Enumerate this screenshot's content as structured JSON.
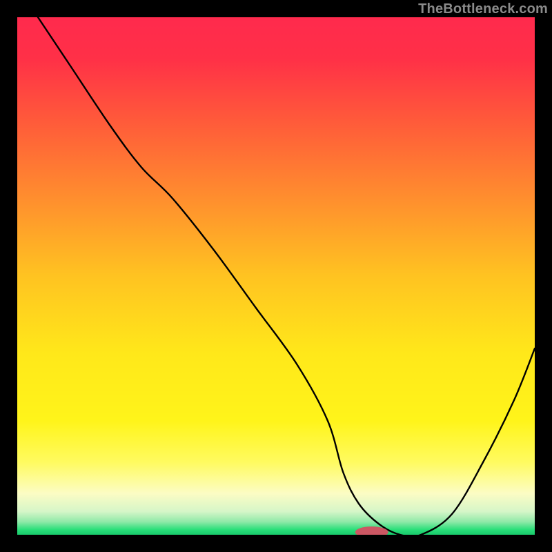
{
  "watermark": "TheBottleneck.com",
  "chart_data": {
    "type": "line",
    "title": "",
    "xlabel": "",
    "ylabel": "",
    "xlim": [
      0,
      100
    ],
    "ylim": [
      0,
      100
    ],
    "background_gradient": {
      "stops": [
        {
          "offset": 0.0,
          "color": "#ff2a4d"
        },
        {
          "offset": 0.08,
          "color": "#ff3047"
        },
        {
          "offset": 0.2,
          "color": "#ff5a3a"
        },
        {
          "offset": 0.35,
          "color": "#ff8e2e"
        },
        {
          "offset": 0.5,
          "color": "#ffc321"
        },
        {
          "offset": 0.65,
          "color": "#ffe81a"
        },
        {
          "offset": 0.78,
          "color": "#fff41a"
        },
        {
          "offset": 0.86,
          "color": "#fffb60"
        },
        {
          "offset": 0.92,
          "color": "#fcfcc4"
        },
        {
          "offset": 0.955,
          "color": "#d6f6c8"
        },
        {
          "offset": 0.975,
          "color": "#8fe9a8"
        },
        {
          "offset": 0.99,
          "color": "#2adf7a"
        },
        {
          "offset": 1.0,
          "color": "#18c96b"
        }
      ]
    },
    "series": [
      {
        "name": "bottleneck-curve",
        "color": "#000000",
        "x": [
          4,
          10,
          18,
          24,
          30,
          38,
          46,
          54,
          60,
          63,
          66,
          70,
          74,
          78,
          84,
          90,
          96,
          100
        ],
        "y": [
          100,
          91,
          79,
          71,
          65,
          55,
          44,
          33,
          22,
          12,
          6,
          2,
          0,
          0,
          4,
          14,
          26,
          36
        ]
      }
    ],
    "marker": {
      "name": "optimal-point",
      "cx": 68.5,
      "cy": 0.5,
      "rx": 3.2,
      "ry": 1.1,
      "color": "#cc5763"
    }
  }
}
